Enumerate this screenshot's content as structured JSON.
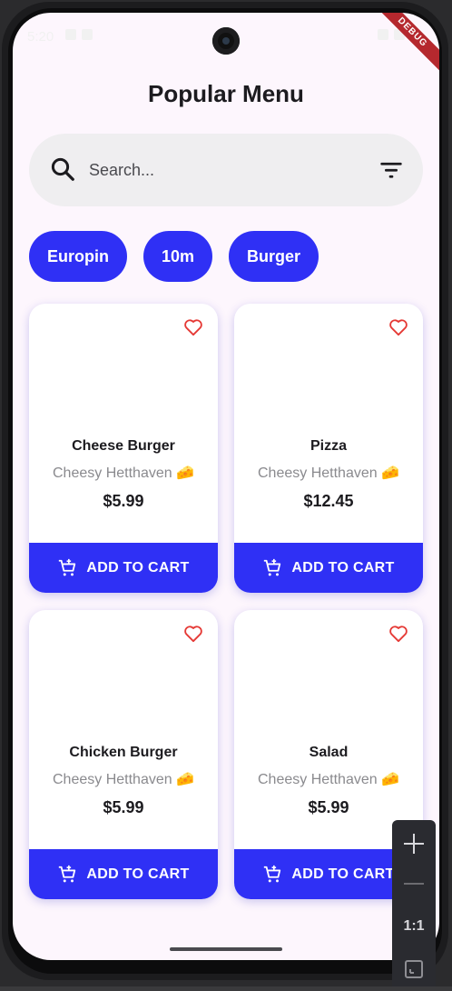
{
  "status_bar": {
    "time": "5:20"
  },
  "debug_banner": "DEBUG",
  "title": "Popular Menu",
  "search": {
    "placeholder": "Search..."
  },
  "chips": [
    "Europin",
    "10m",
    "Burger"
  ],
  "products": [
    {
      "name": "Cheese Burger",
      "description": "Cheesy Hetthaven 🧀",
      "price": "$5.99",
      "button": "ADD TO CART"
    },
    {
      "name": "Pizza",
      "description": "Cheesy Hetthaven 🧀",
      "price": "$12.45",
      "button": "ADD TO CART"
    },
    {
      "name": "Chicken Burger",
      "description": "Cheesy Hetthaven 🧀",
      "price": "$5.99",
      "button": "ADD TO CART"
    },
    {
      "name": "Salad",
      "description": "Cheesy Hetthaven 🧀",
      "price": "$5.99",
      "button": "ADD TO CART"
    }
  ],
  "zoom_panel": {
    "reset_label": "1:1"
  },
  "colors": {
    "accent": "#2f30f5",
    "background": "#fdf6fd",
    "favorite": "#e53935",
    "search_bg": "#efeef0"
  },
  "icons": {
    "search": "search-icon",
    "filter": "filter-icon",
    "favorite": "heart-outline-icon",
    "cart": "add-shopping-cart-icon",
    "zoom_in": "plus-icon",
    "zoom_out": "minus-icon",
    "fit": "fit-screen-icon"
  }
}
